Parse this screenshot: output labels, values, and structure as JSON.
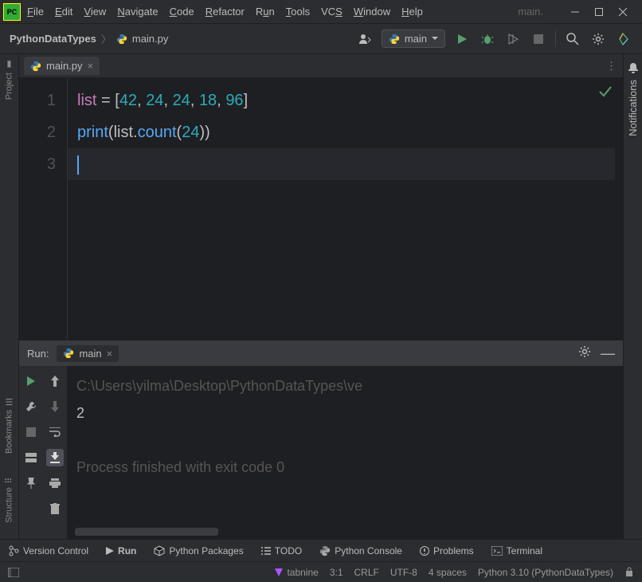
{
  "title_suffix": "main.",
  "menu": [
    "File",
    "Edit",
    "View",
    "Navigate",
    "Code",
    "Refactor",
    "Run",
    "Tools",
    "VCS",
    "Window",
    "Help"
  ],
  "breadcrumb": {
    "project": "PythonDataTypes",
    "file": "main.py"
  },
  "runconfig": "main",
  "tab": {
    "name": "main.py"
  },
  "editor": {
    "lines": [
      "1",
      "2",
      "3"
    ],
    "code": {
      "l1_var": "list",
      "l1_eq": " = ",
      "l1_open": "[",
      "l1_n1": "42",
      "l1_c": ", ",
      "l1_n2": "24",
      "l1_n3": "24",
      "l1_n4": "18",
      "l1_n5": "96",
      "l1_close": "]",
      "l2_fn": "print",
      "l2_p1": "(",
      "l2_obj": "list",
      "l2_dot": ".",
      "l2_m": "count",
      "l2_p2": "(",
      "l2_arg": "24",
      "l2_p3": ")",
      "l2_p4": ")"
    }
  },
  "run": {
    "label": "Run:",
    "tab": "main",
    "cmd": "C:\\Users\\yilma\\Desktop\\PythonDataTypes\\ve",
    "output": "2",
    "exitmsg": "Process finished with exit code 0"
  },
  "left_rail": [
    "Project",
    "Bookmarks",
    "Structure"
  ],
  "right_rail": "Notifications",
  "bottom": {
    "vc": "Version Control",
    "run": "Run",
    "pkg": "Python Packages",
    "todo": "TODO",
    "pycon": "Python Console",
    "prob": "Problems",
    "term": "Terminal"
  },
  "status": {
    "tabnine": "tabnine",
    "pos": "3:1",
    "eol": "CRLF",
    "enc": "UTF-8",
    "indent": "4 spaces",
    "interp": "Python 3.10 (PythonDataTypes)"
  }
}
